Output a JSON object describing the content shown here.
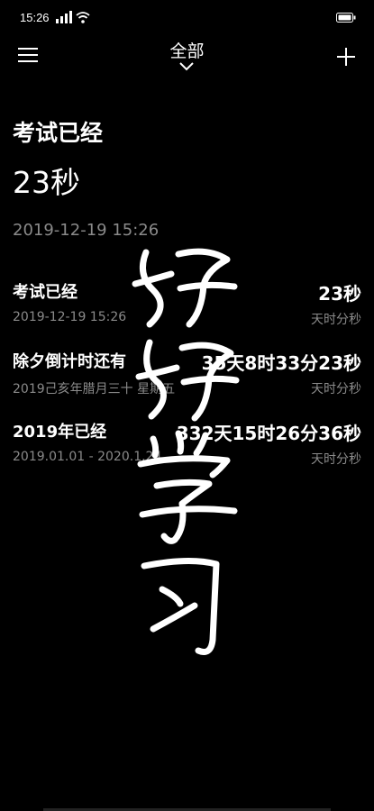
{
  "status_bar": {
    "time": "15:26",
    "icons": [
      "signal-icon",
      "wifi-icon",
      "battery-icon"
    ]
  },
  "header": {
    "title": "全部",
    "icons": [
      "menu-icon",
      "chevron-down-icon",
      "plus-icon"
    ]
  },
  "hero": {
    "label": "考试已经",
    "value": "23秒",
    "date": "2019-12-19 15:26"
  },
  "items": [
    {
      "title": "考试已经",
      "value": "23秒",
      "subtitle": "2019-12-19 15:26",
      "unit": "天时分秒"
    },
    {
      "title": "除夕倒计时还有",
      "value": "35天8时33分23秒",
      "subtitle": "2019己亥年腊月三十 星期五",
      "unit": "天时分秒"
    },
    {
      "title": "2019年已经",
      "value": "332天15时26分36秒",
      "subtitle": "2019.01.01 - 2020.1.24",
      "unit": "天时分秒"
    }
  ],
  "wallpaper": {
    "text": "好好学习"
  },
  "colors": {
    "background": "#000000",
    "text": "#ffffff",
    "secondary": "#8a8a8a"
  }
}
